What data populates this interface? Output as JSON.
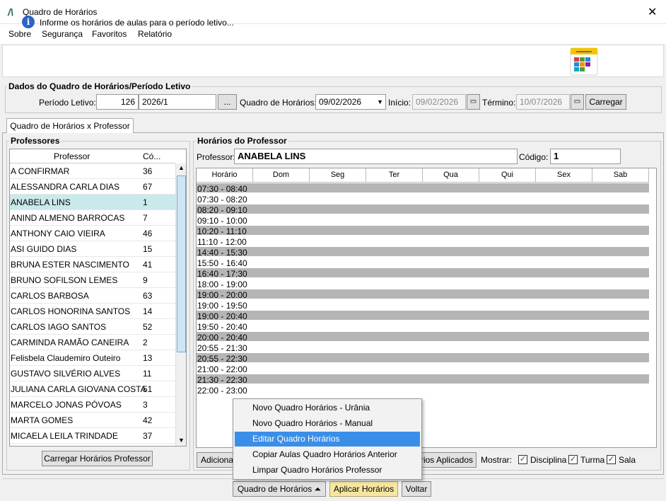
{
  "window": {
    "title": "Quadro de Horários",
    "close": "✕"
  },
  "menu": [
    "Sobre",
    "Segurança",
    "Favoritos",
    "Relatório"
  ],
  "info": {
    "text": "Informe os horários de aulas para o período letivo..."
  },
  "dados": {
    "legend": "Dados do Quadro de Horários/Período Letivo",
    "periodo_label": "Período Letivo:",
    "periodo_code": "126",
    "periodo_value": "2026/1",
    "ellipsis": "...",
    "quadro_label": "Quadro de Horários:",
    "quadro_value": "09/02/2026",
    "inicio_label": "Início:",
    "inicio_value": "09/02/2026",
    "termino_label": "Término:",
    "termino_value": "10/07/2026",
    "carregar": "Carregar"
  },
  "tab": {
    "label": "Quadro de Horários x Professor"
  },
  "professores": {
    "legend": "Professores",
    "col_name": "Professor",
    "col_code": "Có...",
    "rows": [
      {
        "name": "A CONFIRMAR",
        "code": "36"
      },
      {
        "name": "ALESSANDRA CARLA DIAS",
        "code": "67"
      },
      {
        "name": "ANABELA LINS",
        "code": "1"
      },
      {
        "name": "ANIND ALMENO BARROCAS",
        "code": "7"
      },
      {
        "name": "ANTHONY CAIO VIEIRA",
        "code": "46"
      },
      {
        "name": "ASI GUIDO DIAS",
        "code": "15"
      },
      {
        "name": "BRUNA ESTER NASCIMENTO",
        "code": "41"
      },
      {
        "name": "BRUNO SOFILSON LEMES",
        "code": "9"
      },
      {
        "name": "CARLOS BARBOSA",
        "code": "63"
      },
      {
        "name": "CARLOS HONORINA SANTOS",
        "code": "14"
      },
      {
        "name": "CARLOS IAGO SANTOS",
        "code": "52"
      },
      {
        "name": "CARMINDA RAMÃO CANEIRA",
        "code": "2"
      },
      {
        "name": "Felisbela Claudemiro Outeiro",
        "code": "13"
      },
      {
        "name": "GUSTAVO SILVÉRIO ALVES",
        "code": "11"
      },
      {
        "name": "JULIANA CARLA GIOVANA COSTA",
        "code": "51"
      },
      {
        "name": "MARCELO JONAS PÓVOAS",
        "code": "3"
      },
      {
        "name": "MARTA GOMES",
        "code": "42"
      },
      {
        "name": "MICAELA LEILA TRINDADE",
        "code": "37"
      }
    ],
    "selected_index": 2,
    "load_button": "Carregar Horários Professor"
  },
  "horarios": {
    "legend": "Horários do Professor",
    "professor_label": "Professor:",
    "professor_value": "ANABELA LINS",
    "codigo_label": "Código:",
    "codigo_value": "1",
    "columns": [
      "Horário",
      "Dom",
      "Seg",
      "Ter",
      "Qua",
      "Qui",
      "Sex",
      "Sab"
    ],
    "rows": [
      {
        "time": "07:30 - 08:40",
        "dark": true
      },
      {
        "time": "07:30 - 08:20",
        "dark": false
      },
      {
        "time": "08:20 - 09:10",
        "dark": true
      },
      {
        "time": "09:10 - 10:00",
        "dark": false
      },
      {
        "time": "10:20 - 11:10",
        "dark": true
      },
      {
        "time": "11:10 - 12:00",
        "dark": false
      },
      {
        "time": "14:40 - 15:30",
        "dark": true
      },
      {
        "time": "15:50 - 16:40",
        "dark": false
      },
      {
        "time": "16:40 - 17:30",
        "dark": true
      },
      {
        "time": "18:00 - 19:00",
        "dark": false
      },
      {
        "time": "19:00 - 20:00",
        "dark": true
      },
      {
        "time": "19:00 - 19:50",
        "dark": false
      },
      {
        "time": "19:00 - 20:40",
        "dark": true
      },
      {
        "time": "19:50 - 20:40",
        "dark": false
      },
      {
        "time": "20:00 - 20:40",
        "dark": true
      },
      {
        "time": "20:55 - 21:30",
        "dark": false
      },
      {
        "time": "20:55 - 22:30",
        "dark": true
      },
      {
        "time": "21:00 - 22:00",
        "dark": false
      },
      {
        "time": "21:30 - 22:30",
        "dark": true
      },
      {
        "time": "22:00 - 23:00",
        "dark": false
      }
    ]
  },
  "actions": {
    "adicionar": "Adicionar",
    "aplicados": "rios Aplicados",
    "mostrar_label": "Mostrar:",
    "disciplina": "Disciplina",
    "turma": "Turma",
    "sala": "Sala",
    "check": "✓"
  },
  "popup": {
    "items": [
      "Novo Quadro Horários - Urânia",
      "Novo Quadro Horários - Manual",
      "Editar Quadro Horários",
      "Copiar Aulas Quadro Horários Anterior",
      "Limpar Quadro Horários Professor"
    ],
    "highlighted_index": 2
  },
  "bottom": {
    "quadro_button": "Quadro de Horários ⏶",
    "aplicar_button": "Aplicar Horários",
    "voltar_button": "Voltar"
  }
}
